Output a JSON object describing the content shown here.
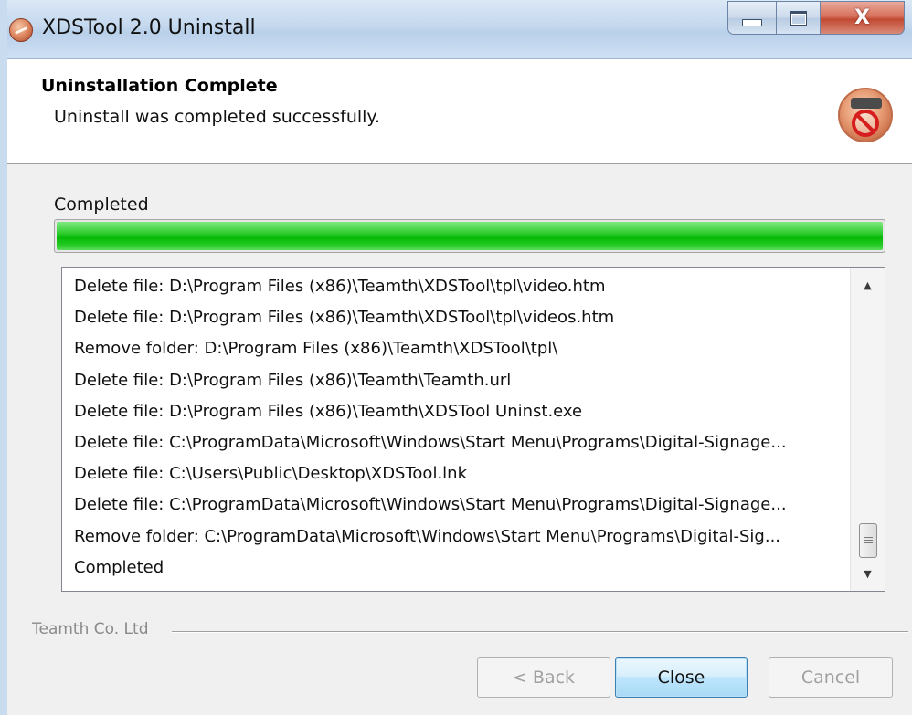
{
  "window": {
    "title": "XDSTool 2.0 Uninstall",
    "close_glyph": "X"
  },
  "header": {
    "heading": "Uninstallation Complete",
    "subheading": "Uninstall was completed successfully.",
    "icon": "uninstall-icon"
  },
  "status": {
    "label": "Completed",
    "progress_percent": 100,
    "progress_color": "#05b805"
  },
  "log": {
    "lines": [
      "Delete file: D:\\Program Files (x86)\\Teamth\\XDSTool\\tpl\\video.htm",
      "Delete file: D:\\Program Files (x86)\\Teamth\\XDSTool\\tpl\\videos.htm",
      "Remove folder: D:\\Program Files (x86)\\Teamth\\XDSTool\\tpl\\",
      "Delete file: D:\\Program Files (x86)\\Teamth\\Teamth.url",
      "Delete file: D:\\Program Files (x86)\\Teamth\\XDSTool Uninst.exe",
      "Delete file: C:\\ProgramData\\Microsoft\\Windows\\Start Menu\\Programs\\Digital-Signage...",
      "Delete file: C:\\Users\\Public\\Desktop\\XDSTool.lnk",
      "Delete file: C:\\ProgramData\\Microsoft\\Windows\\Start Menu\\Programs\\Digital-Signage...",
      "Remove folder: C:\\ProgramData\\Microsoft\\Windows\\Start Menu\\Programs\\Digital-Sig...",
      "Completed"
    ],
    "scroll_up_glyph": "▲",
    "scroll_down_glyph": "▼"
  },
  "branding": "Teamth Co. Ltd",
  "buttons": {
    "back": "< Back",
    "close": "Close",
    "cancel": "Cancel"
  }
}
